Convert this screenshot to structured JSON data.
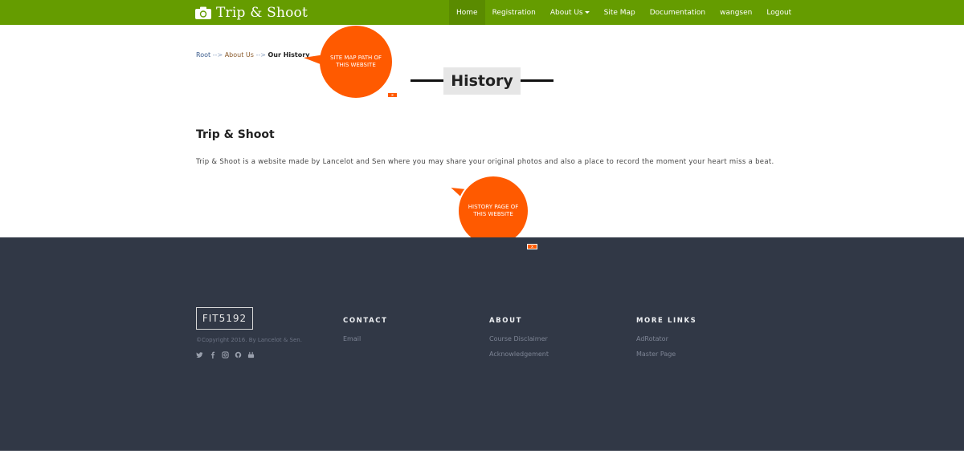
{
  "navbar": {
    "brand": "Trip & Shoot",
    "brand_icon": "camera-icon",
    "items": [
      {
        "label": "Home",
        "active": true
      },
      {
        "label": "Registration"
      },
      {
        "label": "About Us",
        "dropdown": true
      },
      {
        "label": "Site Map"
      },
      {
        "label": "Documentation"
      },
      {
        "label": "wangsen"
      },
      {
        "label": "Logout"
      }
    ]
  },
  "breadcrumb": {
    "root": "Root",
    "sep1": "-->",
    "about": "About Us",
    "sep2": "-->",
    "current": "Our History"
  },
  "page": {
    "title": "History",
    "heading": "Trip & Shoot",
    "body": "Trip & Shoot is a website made by Lancelot and Sen where you may share your original photos and also a place to record the moment your heart miss a beat."
  },
  "callouts": [
    {
      "text": "SITE MAP PATH OF THIS WEBSITE",
      "close": "x"
    },
    {
      "text": "HISTORY PAGE OF THIS WEBSITE",
      "close": "x"
    }
  ],
  "footer": {
    "logo": "FIT5192",
    "copyright": "©Copyright 2016. By Lancelot & Sen.",
    "social_icons": [
      "twitter-icon",
      "facebook-icon",
      "instagram-icon",
      "github-icon",
      "youtube-icon"
    ],
    "columns": [
      {
        "title": "CONTACT",
        "links": [
          "Email"
        ]
      },
      {
        "title": "ABOUT",
        "links": [
          "Course Disclaimer",
          "Acknowledgement"
        ]
      },
      {
        "title": "MORE LINKS",
        "links": [
          "AdRotator",
          "Master Page"
        ]
      }
    ]
  },
  "colors": {
    "navbar": "#659c00",
    "accent_callout": "#ff5a00",
    "footer": "#313846"
  }
}
